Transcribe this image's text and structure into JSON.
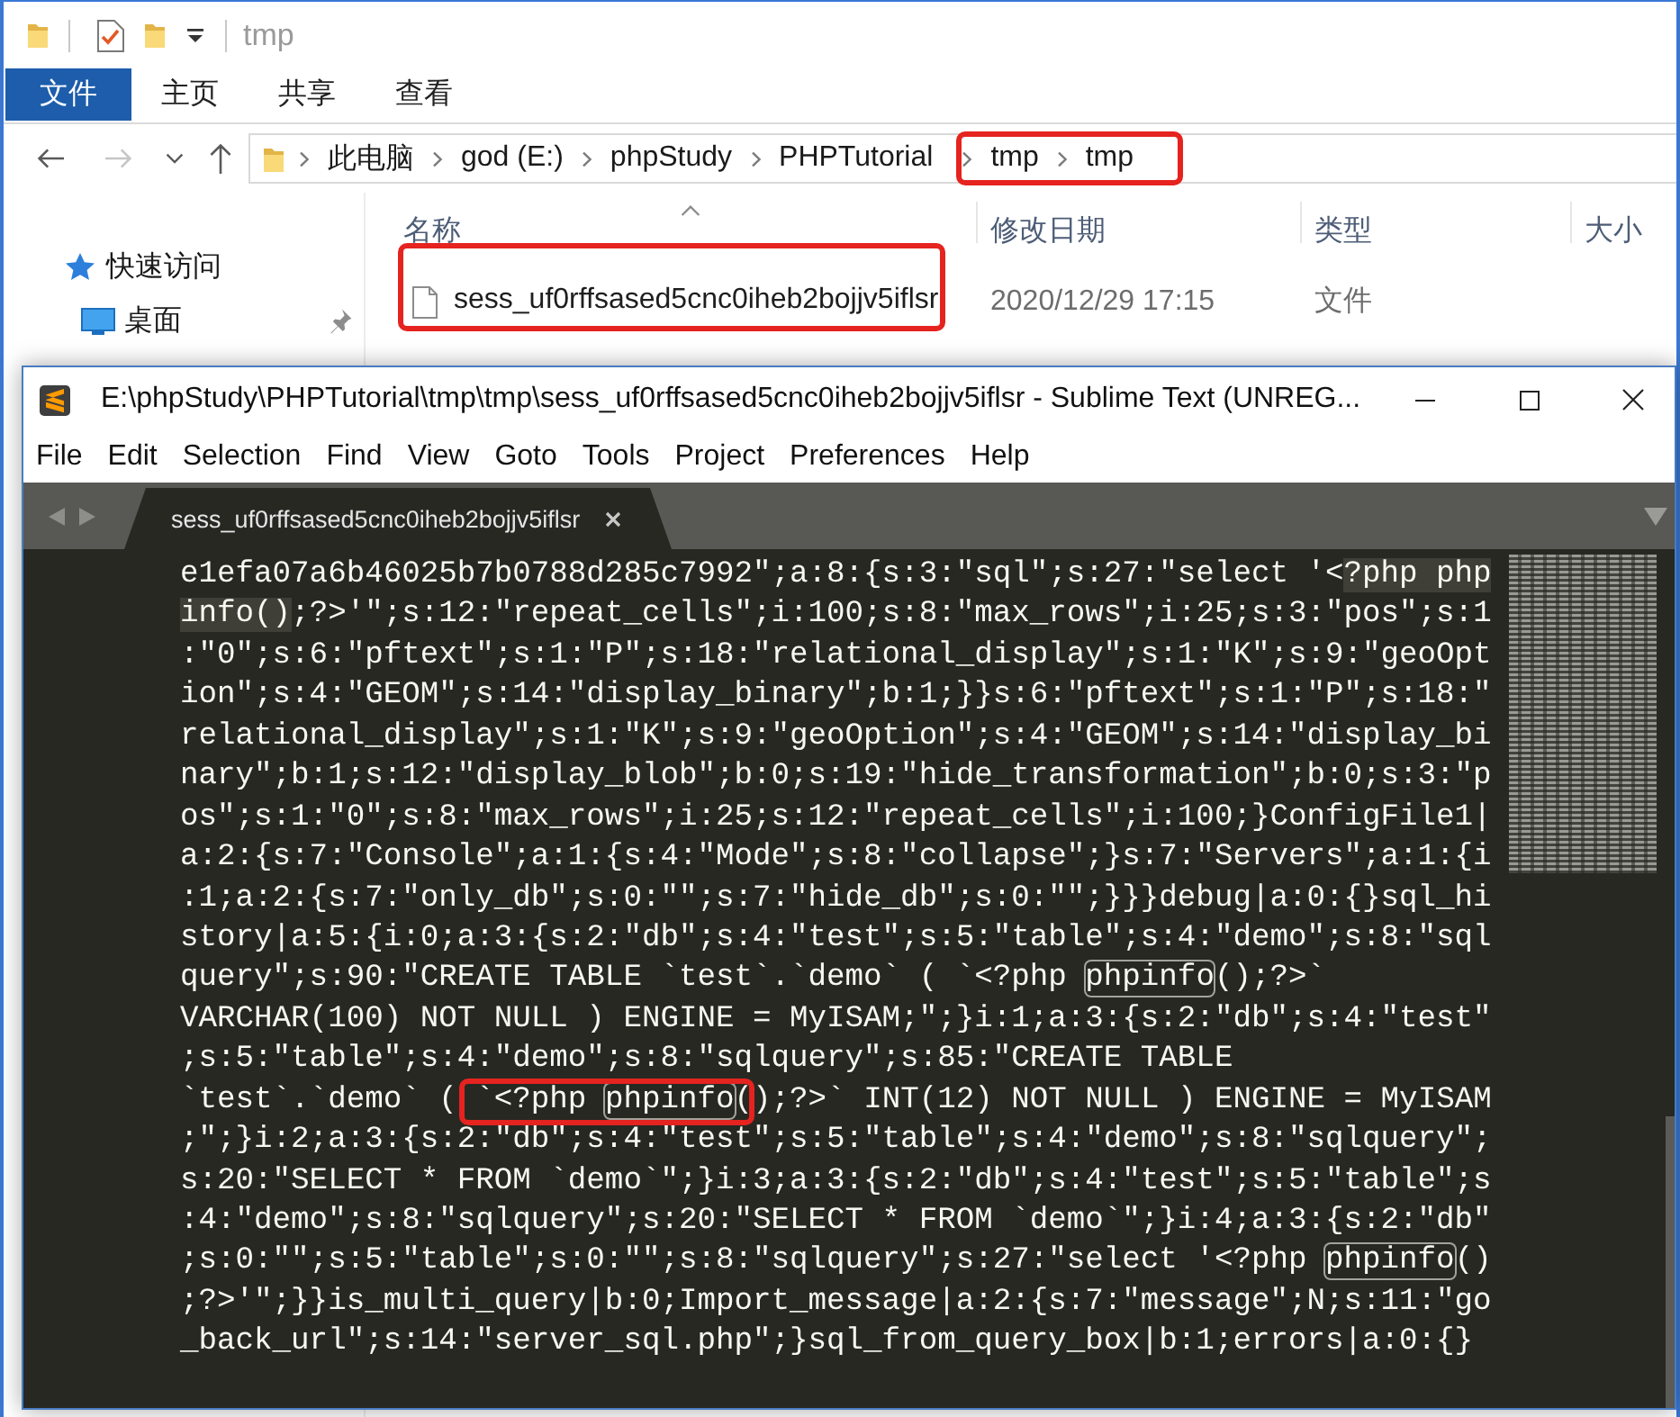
{
  "explorer": {
    "title": "tmp",
    "ribbon_tabs": [
      {
        "label": "文件",
        "kind": "file"
      },
      {
        "label": "主页",
        "kind": "tab"
      },
      {
        "label": "共享",
        "kind": "tab"
      },
      {
        "label": "查看",
        "kind": "tab"
      }
    ],
    "nav_buttons": [
      {
        "kind": "back",
        "disabled": false
      },
      {
        "kind": "forward",
        "disabled": true
      },
      {
        "kind": "recent",
        "disabled": false
      },
      {
        "kind": "up",
        "disabled": false
      }
    ],
    "breadcrumbs": [
      {
        "label": "此电脑",
        "annotated": false
      },
      {
        "label": "god (E:)",
        "annotated": false
      },
      {
        "label": "phpStudy",
        "annotated": false
      },
      {
        "label": "PHPTutorial",
        "annotated": false
      },
      {
        "label": "tmp",
        "annotated": true
      },
      {
        "label": "tmp",
        "annotated": true
      }
    ],
    "nav_items": [
      {
        "label": "快速访问",
        "kind": "group",
        "pinned": false
      },
      {
        "label": "桌面",
        "kind": "item",
        "pinned": true
      }
    ],
    "columns": [
      {
        "label": "名称",
        "sorted": true
      },
      {
        "label": "修改日期",
        "sorted": false
      },
      {
        "label": "类型",
        "sorted": false
      },
      {
        "label": "大小",
        "sorted": false
      }
    ],
    "rows": [
      {
        "name": "sess_uf0rffsased5cnc0iheb2bojjv5iflsr",
        "modified": "2020/12/29 17:15",
        "type": "文件",
        "annotated": true
      }
    ]
  },
  "editor": {
    "title": "E:\\phpStudy\\PHPTutorial\\tmp\\tmp\\sess_uf0rffsased5cnc0iheb2bojjv5iflsr - Sublime Text (UNREG...",
    "menu": [
      "File",
      "Edit",
      "Selection",
      "Find",
      "View",
      "Goto",
      "Tools",
      "Project",
      "Preferences",
      "Help"
    ],
    "tabs": [
      {
        "label": "sess_uf0rffsased5cnc0iheb2bojjv5iflsr",
        "selected": true
      }
    ],
    "lines": [
      {
        "segments": [
          {
            "kind": "plain",
            "text": "e1efa07a6b46025b7b0788d285c7992\";a:8:{s:3:\"sql\";s:27:\"select '<"
          },
          {
            "kind": "selection",
            "text": "?php php"
          }
        ]
      },
      {
        "segments": [
          {
            "kind": "selection",
            "text": "info()"
          },
          {
            "kind": "plain",
            "text": ";?>'\";s:12:\"repeat_cells\";i:100;s:8:\"max_rows\";i:25;s:3:\"pos\";s:1"
          }
        ]
      },
      {
        "segments": [
          {
            "kind": "plain",
            "text": ":\"0\";s:6:\"pftext\";s:1:\"P\";s:18:\"relational_display\";s:1:\"K\";s:9:\"geoOpt"
          }
        ]
      },
      {
        "segments": [
          {
            "kind": "plain",
            "text": "ion\";s:4:\"GEOM\";s:14:\"display_binary\";b:1;}}s:6:\"pftext\";s:1:\"P\";s:18:\""
          }
        ]
      },
      {
        "segments": [
          {
            "kind": "plain",
            "text": "relational_display\";s:1:\"K\";s:9:\"geoOption\";s:4:\"GEOM\";s:14:\"display_bi"
          }
        ]
      },
      {
        "segments": [
          {
            "kind": "plain",
            "text": "nary\";b:1;s:12:\"display_blob\";b:0;s:19:\"hide_transformation\";b:0;s:3:\"p"
          }
        ]
      },
      {
        "segments": [
          {
            "kind": "plain",
            "text": "os\";s:1:\"0\";s:8:\"max_rows\";i:25;s:12:\"repeat_cells\";i:100;}ConfigFile1|"
          }
        ]
      },
      {
        "segments": [
          {
            "kind": "plain",
            "text": "a:2:{s:7:\"Console\";a:1:{s:4:\"Mode\";s:8:\"collapse\";}s:7:\"Servers\";a:1:{i"
          }
        ]
      },
      {
        "segments": [
          {
            "kind": "plain",
            "text": ":1;a:2:{s:7:\"only_db\";s:0:\"\";s:7:\"hide_db\";s:0:\"\";}}}debug|a:0:{}sql_hi"
          }
        ]
      },
      {
        "segments": [
          {
            "kind": "plain",
            "text": "story|a:5:{i:0;a:3:{s:2:\"db\";s:4:\"test\";s:5:\"table\";s:4:\"demo\";s:8:\"sql"
          }
        ]
      },
      {
        "segments": [
          {
            "kind": "plain",
            "text": "query\";s:90:\"CREATE TABLE `test`.`demo` ( `<?php "
          },
          {
            "kind": "match",
            "text": "phpinfo"
          },
          {
            "kind": "plain",
            "text": "();?>`"
          }
        ]
      },
      {
        "segments": [
          {
            "kind": "plain",
            "text": "VARCHAR(100) NOT NULL ) ENGINE = MyISAM;\";}i:1;a:3:{s:2:\"db\";s:4:\"test\""
          }
        ]
      },
      {
        "segments": [
          {
            "kind": "plain",
            "text": ";s:5:\"table\";s:4:\"demo\";s:8:\"sqlquery\";s:85:\"CREATE TABLE"
          }
        ]
      },
      {
        "segments": [
          {
            "kind": "plain",
            "text": "`test`.`demo` ( "
          },
          {
            "kind": "annotation",
            "segments": [
              {
                "kind": "plain",
                "text": "`<?php "
              },
              {
                "kind": "match",
                "text": "phpinfo"
              },
              {
                "kind": "plain",
                "text": "("
              }
            ]
          },
          {
            "kind": "plain",
            "text": ");?>` INT(12) NOT NULL ) ENGINE = MyISAM"
          }
        ]
      },
      {
        "segments": [
          {
            "kind": "plain",
            "text": ";\";}i:2;a:3:{s:2:\"db\";s:4:\"test\";s:5:\"table\";s:4:\"demo\";s:8:\"sqlquery\";"
          }
        ]
      },
      {
        "segments": [
          {
            "kind": "plain",
            "text": "s:20:\"SELECT * FROM `demo`\";}i:3;a:3:{s:2:\"db\";s:4:\"test\";s:5:\"table\";s"
          }
        ]
      },
      {
        "segments": [
          {
            "kind": "plain",
            "text": ":4:\"demo\";s:8:\"sqlquery\";s:20:\"SELECT * FROM `demo`\";}i:4;a:3:{s:2:\"db\""
          }
        ]
      },
      {
        "segments": [
          {
            "kind": "plain",
            "text": ";s:0:\"\";s:5:\"table\";s:0:\"\";s:8:\"sqlquery\";s:27:\"select '<?php "
          },
          {
            "kind": "match",
            "text": "phpinfo"
          },
          {
            "kind": "plain",
            "text": "()"
          }
        ]
      },
      {
        "segments": [
          {
            "kind": "plain",
            "text": ";?>'\";}}is_multi_query|b:0;Import_message|a:2:{s:7:\"message\";N;s:11:\"go"
          }
        ]
      },
      {
        "segments": [
          {
            "kind": "plain",
            "text": "_back_url\";s:14:\"server_sql.php\";}sql_from_query_box|b:1;errors|a:0:{}"
          }
        ]
      }
    ]
  }
}
